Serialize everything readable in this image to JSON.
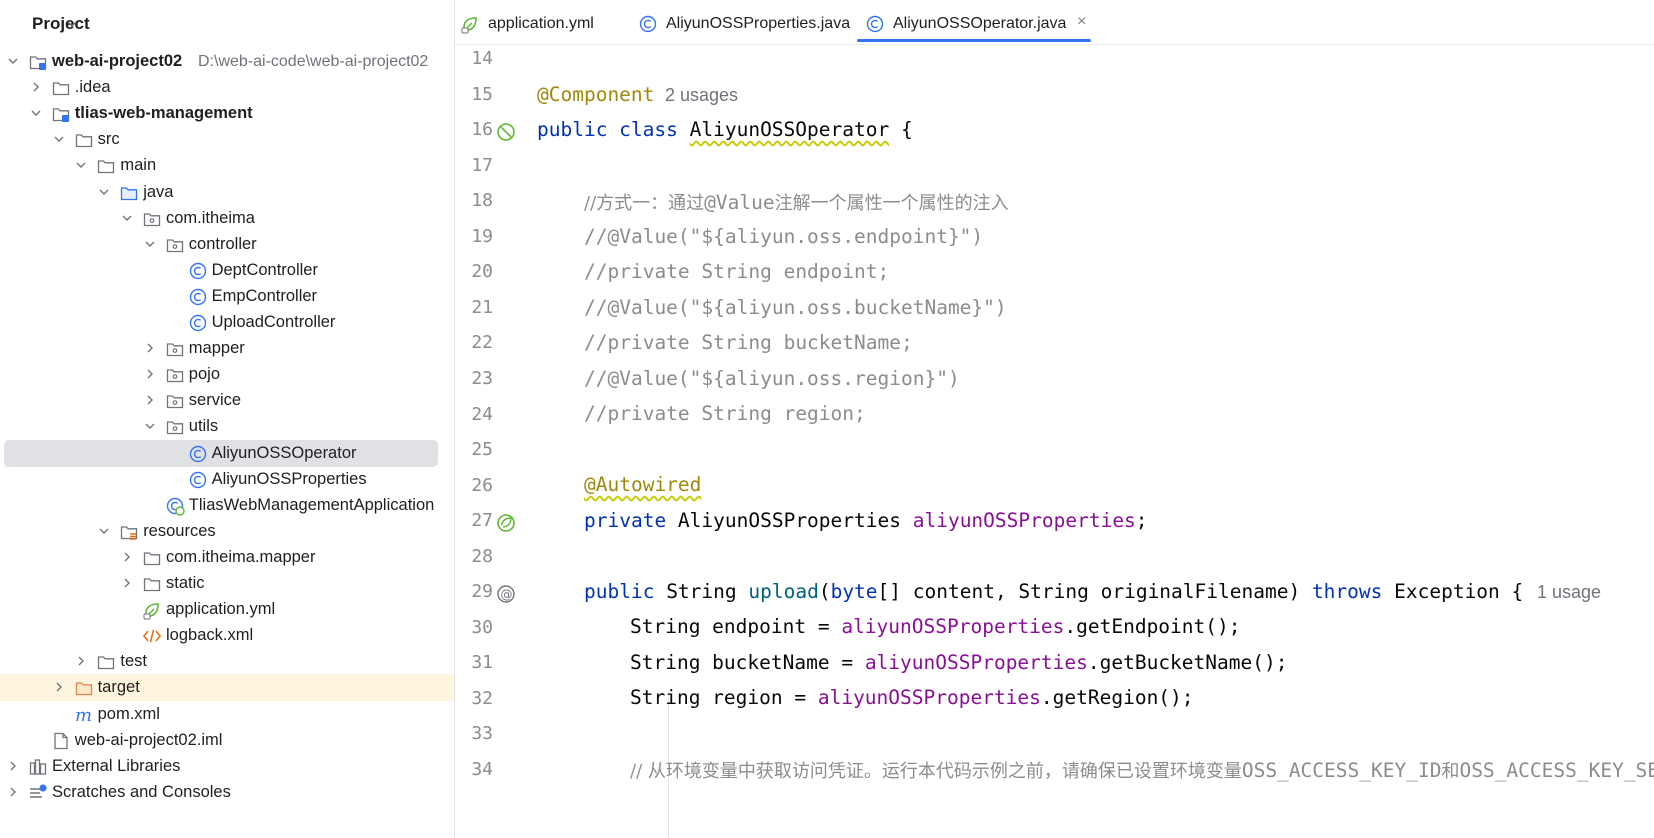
{
  "sidebar": {
    "title": "Project",
    "tree": [
      {
        "label": "web-ai-project02",
        "path": "D:\\web-ai-code\\web-ai-project02",
        "icon": "module-folder-icon",
        "expanded": true
      },
      {
        "label": ".idea",
        "icon": "folder-icon",
        "expanded": false
      },
      {
        "label": "tlias-web-management",
        "icon": "module-folder-icon",
        "expanded": true
      },
      {
        "label": "src",
        "icon": "folder-icon",
        "expanded": true
      },
      {
        "label": "main",
        "icon": "folder-icon",
        "expanded": true
      },
      {
        "label": "java",
        "icon": "source-folder-icon",
        "expanded": true
      },
      {
        "label": "com.itheima",
        "icon": "package-icon",
        "expanded": true
      },
      {
        "label": "controller",
        "icon": "package-icon",
        "expanded": true
      },
      {
        "label": "DeptController",
        "icon": "class-icon"
      },
      {
        "label": "EmpController",
        "icon": "class-icon"
      },
      {
        "label": "UploadController",
        "icon": "class-icon"
      },
      {
        "label": "mapper",
        "icon": "package-icon",
        "expanded": false
      },
      {
        "label": "pojo",
        "icon": "package-icon",
        "expanded": false
      },
      {
        "label": "service",
        "icon": "package-icon",
        "expanded": false
      },
      {
        "label": "utils",
        "icon": "package-icon",
        "expanded": true
      },
      {
        "label": "AliyunOSSOperator",
        "icon": "class-icon",
        "selected": true
      },
      {
        "label": "AliyunOSSProperties",
        "icon": "class-icon"
      },
      {
        "label": "TliasWebManagementApplication",
        "icon": "spring-boot-class-icon"
      },
      {
        "label": "resources",
        "icon": "resources-folder-icon",
        "expanded": true
      },
      {
        "label": "com.itheima.mapper",
        "icon": "folder-icon",
        "expanded": false
      },
      {
        "label": "static",
        "icon": "folder-icon",
        "expanded": false
      },
      {
        "label": "application.yml",
        "icon": "spring-yml-icon"
      },
      {
        "label": "logback.xml",
        "icon": "xml-icon"
      },
      {
        "label": "test",
        "icon": "folder-icon",
        "expanded": false
      },
      {
        "label": "target",
        "icon": "excluded-folder-icon",
        "expanded": false
      },
      {
        "label": "pom.xml",
        "icon": "maven-icon"
      },
      {
        "label": "web-ai-project02.iml",
        "icon": "iml-file-icon"
      },
      {
        "label": "External Libraries",
        "icon": "libraries-icon",
        "expanded": false
      },
      {
        "label": "Scratches and Consoles",
        "icon": "scratches-icon",
        "expanded": false
      }
    ]
  },
  "tabs": [
    {
      "label": "application.yml",
      "icon": "spring-yml-icon"
    },
    {
      "label": "AliyunOSSProperties.java",
      "icon": "class-icon"
    },
    {
      "label": "AliyunOSSOperator.java",
      "icon": "class-icon",
      "active": true,
      "close": "×"
    }
  ],
  "editor": {
    "line_numbers": [
      "14",
      "15",
      "16",
      "17",
      "18",
      "19",
      "20",
      "21",
      "22",
      "23",
      "24",
      "25",
      "26",
      "27",
      "28",
      "29",
      "30",
      "31",
      "32",
      "33",
      "34"
    ],
    "lines": {
      "l15_ann": "@Component",
      "l15_hint": "2 usages",
      "l16_a": "public class ",
      "l16_b": "AliyunOSSOperator",
      "l16_c": " {",
      "l18_a": "//方式一：通过",
      "l18_b": "@Value",
      "l18_c": "注解一个属性一个属性的注入",
      "l19": "//@Value(\"${aliyun.oss.endpoint}\")",
      "l20": "//private String endpoint;",
      "l21": "//@Value(\"${aliyun.oss.bucketName}\")",
      "l22": "//private String bucketName;",
      "l23": "//@Value(\"${aliyun.oss.region}\")",
      "l24": "//private String region;",
      "l26": "@Autowired",
      "l27_a": "private ",
      "l27_b": "AliyunOSSProperties ",
      "l27_c": "aliyunOSSProperties",
      "l27_d": ";",
      "l29_a": "public ",
      "l29_b": "String ",
      "l29_c": "upload",
      "l29_d": "(",
      "l29_e": "byte",
      "l29_f": "[] content, String originalFilename) ",
      "l29_g": "throws",
      "l29_h": " Exception {",
      "l29_hint": "1 usage",
      "l30_a": "String endpoint = ",
      "l30_b": "aliyunOSSProperties",
      "l30_c": ".getEndpoint();",
      "l31_a": "String bucketName = ",
      "l31_b": "aliyunOSSProperties",
      "l31_c": ".getBucketName();",
      "l32_a": "String region = ",
      "l32_b": "aliyunOSSProperties",
      "l32_c": ".getRegion();",
      "l34_a": "// 从环境变量中获取访问凭证。运行本代码示例之前，请确保已设置环境变量",
      "l34_b": "OSS_ACCESS_KEY_ID",
      "l34_c": "和",
      "l34_d": "OSS_ACCESS_KEY_SECRET"
    }
  },
  "colors": {
    "accent": "#3574f0",
    "keyword": "#0033b3",
    "annotation": "#9e880d",
    "field": "#871094",
    "comment": "#8c8c8c",
    "selection": "#dfe1e5",
    "excluded_row": "#fdf5dd"
  }
}
